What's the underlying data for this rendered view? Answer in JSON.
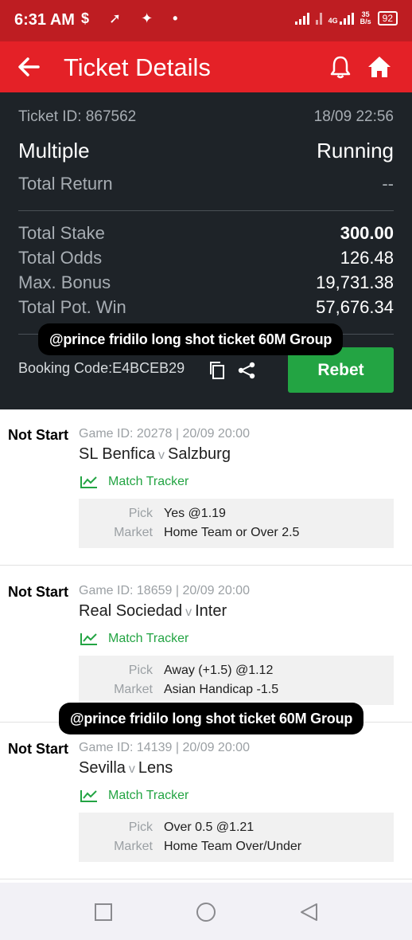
{
  "status_bar": {
    "time": "6:31 AM",
    "network": "4G",
    "speed_value": "35",
    "speed_unit": "B/s",
    "battery": "92"
  },
  "header": {
    "title": "Ticket Details",
    "color": "#e42127"
  },
  "summary": {
    "ticket_id": "Ticket ID: 867562",
    "datetime": "18/09 22:56",
    "bet_type": "Multiple",
    "status": "Running",
    "total_return_label": "Total Return",
    "total_return_value": "--",
    "total_stake_label": "Total Stake",
    "total_stake_value": "300.00",
    "total_odds_label": "Total Odds",
    "total_odds_value": "126.48",
    "max_bonus_label": "Max. Bonus",
    "max_bonus_value": "19,731.38",
    "pot_win_label": "Total Pot. Win",
    "pot_win_value": "57,676.34",
    "booking_code": "Booking Code:E4BCEB29",
    "rebet_label": "Rebet"
  },
  "watermark_text": "@prince fridilo long shot ticket 60M Group",
  "games": [
    {
      "status": "Not Start",
      "meta": "Game ID: 20278 | 20/09 20:00",
      "home": "SL Benfica",
      "vs": "v",
      "away": "Salzburg",
      "tracker": "Match Tracker",
      "pick_label": "Pick",
      "pick_value": "Yes @1.19",
      "market_label": "Market",
      "market_value": "Home Team or Over 2.5"
    },
    {
      "status": "Not Start",
      "meta": "Game ID: 18659 | 20/09 20:00",
      "home": "Real Sociedad",
      "vs": "v",
      "away": "Inter",
      "tracker": "Match Tracker",
      "pick_label": "Pick",
      "pick_value": "Away (+1.5) @1.12",
      "market_label": "Market",
      "market_value": "Asian Handicap -1.5"
    },
    {
      "status": "Not Start",
      "meta": "Game ID: 14139 | 20/09 20:00",
      "home": "Sevilla",
      "vs": "v",
      "away": "Lens",
      "tracker": "Match Tracker",
      "pick_label": "Pick",
      "pick_value": "Over 0.5 @1.21",
      "market_label": "Market",
      "market_value": "Home Team Over/Under"
    }
  ]
}
